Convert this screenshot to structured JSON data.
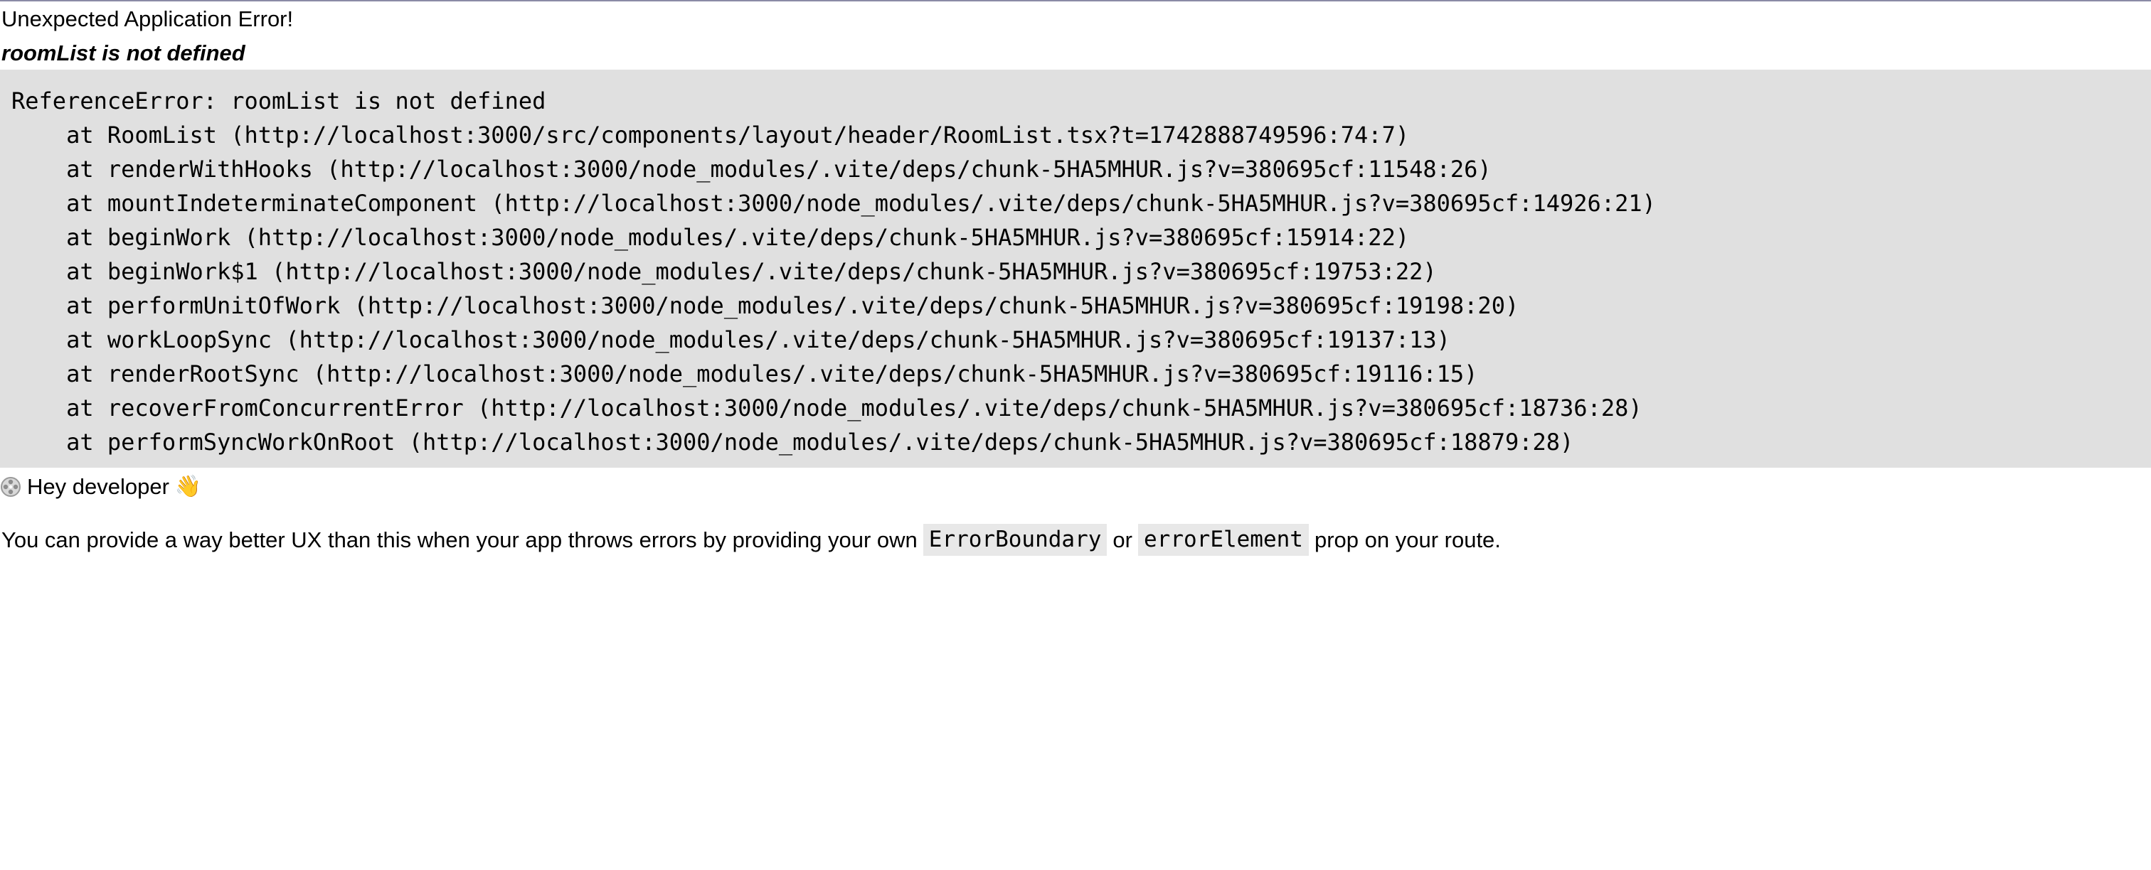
{
  "error": {
    "title": "Unexpected Application Error!",
    "message": "roomList is not defined",
    "stack": [
      "ReferenceError: roomList is not defined",
      "    at RoomList (http://localhost:3000/src/components/layout/header/RoomList.tsx?t=1742888749596:74:7)",
      "    at renderWithHooks (http://localhost:3000/node_modules/.vite/deps/chunk-5HA5MHUR.js?v=380695cf:11548:26)",
      "    at mountIndeterminateComponent (http://localhost:3000/node_modules/.vite/deps/chunk-5HA5MHUR.js?v=380695cf:14926:21)",
      "    at beginWork (http://localhost:3000/node_modules/.vite/deps/chunk-5HA5MHUR.js?v=380695cf:15914:22)",
      "    at beginWork$1 (http://localhost:3000/node_modules/.vite/deps/chunk-5HA5MHUR.js?v=380695cf:19753:22)",
      "    at performUnitOfWork (http://localhost:3000/node_modules/.vite/deps/chunk-5HA5MHUR.js?v=380695cf:19198:20)",
      "    at workLoopSync (http://localhost:3000/node_modules/.vite/deps/chunk-5HA5MHUR.js?v=380695cf:19137:13)",
      "    at renderRootSync (http://localhost:3000/node_modules/.vite/deps/chunk-5HA5MHUR.js?v=380695cf:19116:15)",
      "    at recoverFromConcurrentError (http://localhost:3000/node_modules/.vite/deps/chunk-5HA5MHUR.js?v=380695cf:18736:28)",
      "    at performSyncWorkOnRoot (http://localhost:3000/node_modules/.vite/deps/chunk-5HA5MHUR.js?v=380695cf:18879:28)"
    ]
  },
  "hint": {
    "icon": "disc-icon",
    "heading": "Hey developer",
    "wave": "👋",
    "text_before": "You can provide a way better UX than this when your app throws errors by providing your own",
    "code_1": "ErrorBoundary",
    "text_between": "or",
    "code_2": "errorElement",
    "text_after": "prop on your route."
  },
  "colors": {
    "stack_background": "#e0e0e0",
    "code_chip_background": "#e8e8e8"
  }
}
